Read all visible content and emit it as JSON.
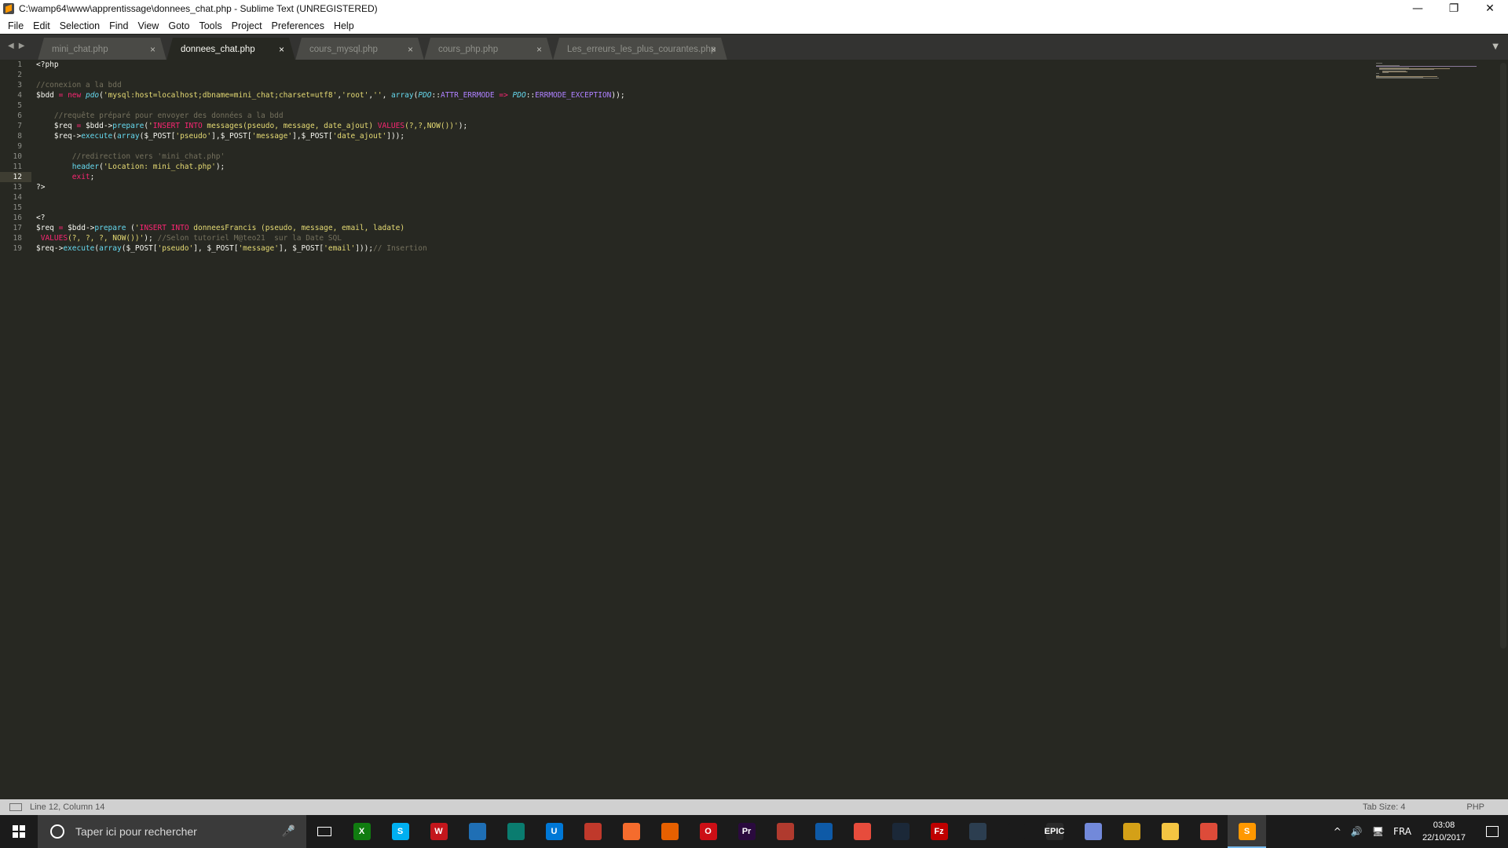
{
  "window": {
    "title": "C:\\wamp64\\www\\apprentissage\\donnees_chat.php - Sublime Text (UNREGISTERED)",
    "minimize": "—",
    "restore": "❐",
    "close": "✕"
  },
  "menu": [
    "File",
    "Edit",
    "Selection",
    "Find",
    "View",
    "Goto",
    "Tools",
    "Project",
    "Preferences",
    "Help"
  ],
  "tabs": [
    {
      "label": "mini_chat.php",
      "active": false
    },
    {
      "label": "donnees_chat.php",
      "active": true
    },
    {
      "label": "cours_mysql.php",
      "active": false
    },
    {
      "label": "cours_php.php",
      "active": false
    },
    {
      "label": "Les_erreurs_les_plus_courantes.php",
      "active": false
    }
  ],
  "tab_close_glyph": "×",
  "nav_arrows": {
    "back": "◀",
    "forward": "▶"
  },
  "tab_dropdown": "▼",
  "editor": {
    "current_line": 12,
    "line_numbers": [
      "1",
      "2",
      "3",
      "4",
      "5",
      "6",
      "7",
      "8",
      "9",
      "10",
      "11",
      "12",
      "13",
      "14",
      "15",
      "16",
      "17",
      "18",
      "19"
    ]
  },
  "status": {
    "position": "Line 12, Column 14",
    "tab_size": "Tab Size: 4",
    "syntax": "PHP"
  },
  "taskbar": {
    "search_placeholder": "Taper ici pour rechercher",
    "mic_glyph": "🎤",
    "apps": [
      {
        "name": "xbox-app",
        "label": "X",
        "color": "#107c10"
      },
      {
        "name": "skype-app",
        "label": "S",
        "color": "#00aff0"
      },
      {
        "name": "winamp-app",
        "label": "W",
        "color": "#c4161c"
      },
      {
        "name": "app-blue",
        "label": "",
        "color": "#1f6fb5"
      },
      {
        "name": "app-teal",
        "label": "",
        "color": "#0a7c6f"
      },
      {
        "name": "app-store",
        "label": "U",
        "color": "#0078d7"
      },
      {
        "name": "app-red",
        "label": "",
        "color": "#c0392b"
      },
      {
        "name": "origin-app",
        "label": "",
        "color": "#f56c2d"
      },
      {
        "name": "firefox-app",
        "label": "",
        "color": "#e66000"
      },
      {
        "name": "opera-app",
        "label": "O",
        "color": "#cc0f16"
      },
      {
        "name": "premiere-app",
        "label": "Pr",
        "color": "#2a0a3e"
      },
      {
        "name": "app-game",
        "label": "",
        "color": "#b03a2e"
      },
      {
        "name": "battlenet-app",
        "label": "",
        "color": "#0e5aa7"
      },
      {
        "name": "app-shapes",
        "label": "",
        "color": "#e74c3c"
      },
      {
        "name": "steam-app",
        "label": "",
        "color": "#1b2838"
      },
      {
        "name": "filezilla-app",
        "label": "Fz",
        "color": "#bf0000"
      },
      {
        "name": "app-shield",
        "label": "",
        "color": "#2c3e50"
      },
      {
        "name": "app-ubisoft",
        "label": "",
        "color": "#1b1b1b"
      },
      {
        "name": "epic-app",
        "label": "EPIC",
        "color": "#2a2a2a"
      },
      {
        "name": "discord-app",
        "label": "",
        "color": "#7289da"
      },
      {
        "name": "app-yellow",
        "label": "",
        "color": "#d4a017"
      },
      {
        "name": "explorer-app",
        "label": "",
        "color": "#f4c542"
      },
      {
        "name": "chrome-app",
        "label": "",
        "color": "#dd4b39"
      },
      {
        "name": "sublime-app",
        "label": "S",
        "color": "#ff9800"
      }
    ],
    "tray": {
      "chevron": "^",
      "volume": "🔊",
      "network": "🖥",
      "language": "FRA",
      "time": "03:08",
      "date": "22/10/2017"
    }
  },
  "colors": {
    "editor_bg": "#272822",
    "comment": "#75715e",
    "keyword": "#f92672",
    "function": "#66d9ef",
    "string": "#e6db74",
    "constant": "#ae81ff"
  }
}
